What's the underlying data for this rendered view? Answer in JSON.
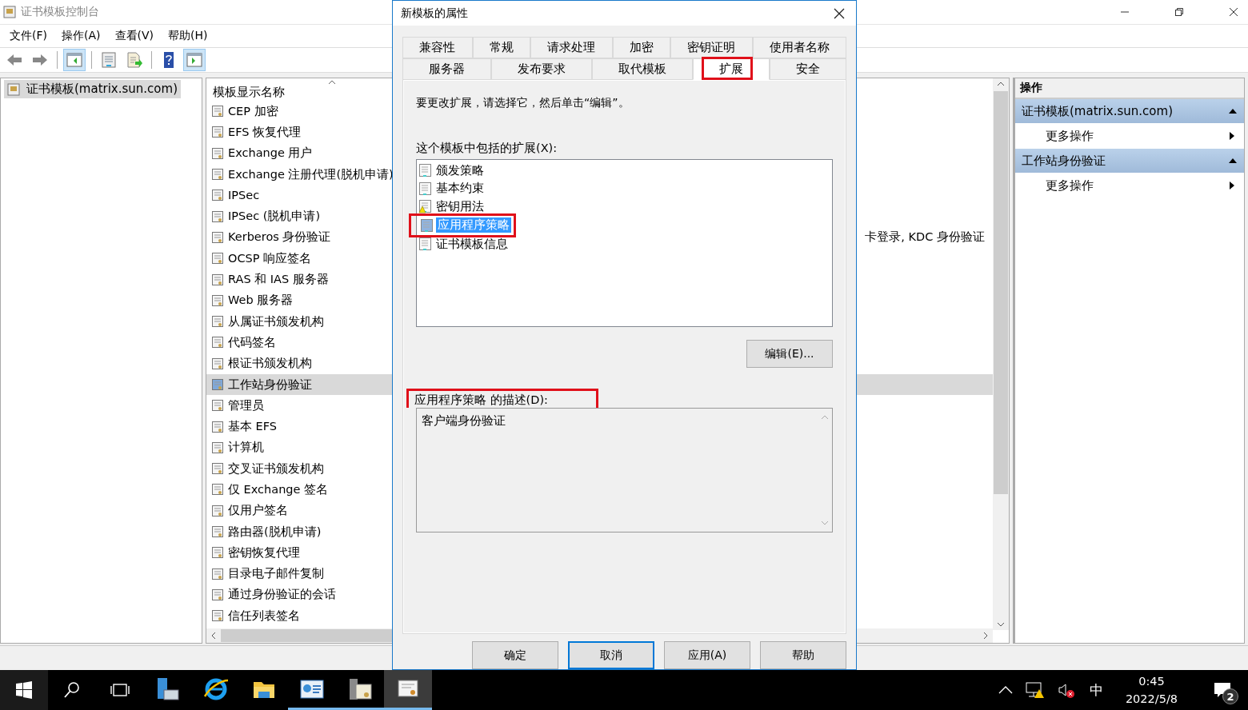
{
  "main_window": {
    "title": "证书模板控制台",
    "menu": [
      "文件(F)",
      "操作(A)",
      "查看(V)",
      "帮助(H)"
    ],
    "toolbar": [
      {
        "kind": "back",
        "pressed": false
      },
      {
        "kind": "forward",
        "pressed": false
      },
      {
        "kind": "tree",
        "pressed": true
      },
      {
        "kind": "properties",
        "pressed": false
      },
      {
        "kind": "export",
        "pressed": false
      },
      {
        "kind": "help",
        "pressed": false
      },
      {
        "kind": "pane",
        "pressed": true
      }
    ],
    "tree": [
      {
        "label": "证书模板(matrix.sun.com)",
        "selected": true
      }
    ],
    "table": {
      "columns": [
        "模板显示名称"
      ],
      "rows": [
        {
          "name": "CEP 加密",
          "selected": false
        },
        {
          "name": "EFS 恢复代理",
          "selected": false
        },
        {
          "name": "Exchange 用户",
          "selected": false
        },
        {
          "name": "Exchange 注册代理(脱机申请)",
          "selected": false
        },
        {
          "name": "IPSec",
          "selected": false
        },
        {
          "name": "IPSec (脱机申请)",
          "selected": false
        },
        {
          "name": "Kerberos 身份验证",
          "selected": false,
          "column_2": "卡登录, KDC 身份验证"
        },
        {
          "name": "OCSP 响应签名",
          "selected": false
        },
        {
          "name": "RAS 和 IAS 服务器",
          "selected": false
        },
        {
          "name": "Web 服务器",
          "selected": false
        },
        {
          "name": "从属证书颁发机构",
          "selected": false
        },
        {
          "name": "代码签名",
          "selected": false
        },
        {
          "name": "根证书颁发机构",
          "selected": false
        },
        {
          "name": "工作站身份验证",
          "selected": true
        },
        {
          "name": "管理员",
          "selected": false
        },
        {
          "name": "基本 EFS",
          "selected": false
        },
        {
          "name": "计算机",
          "selected": false
        },
        {
          "name": "交叉证书颁发机构",
          "selected": false
        },
        {
          "name": "仅 Exchange 签名",
          "selected": false
        },
        {
          "name": "仅用户签名",
          "selected": false
        },
        {
          "name": "路由器(脱机申请)",
          "selected": false
        },
        {
          "name": "密钥恢复代理",
          "selected": false
        },
        {
          "name": "目录电子邮件复制",
          "selected": false
        },
        {
          "name": "通过身份验证的会话",
          "selected": false
        },
        {
          "name": "信任列表签名",
          "selected": false
        }
      ]
    },
    "actions": {
      "title": "操作",
      "groups": [
        {
          "title": "证书模板(matrix.sun.com)",
          "expanded": true,
          "items": [
            "更多操作"
          ]
        },
        {
          "title": "工作站身份验证",
          "expanded": true,
          "items": [
            "更多操作"
          ]
        }
      ]
    }
  },
  "dialog": {
    "title": "新模板的属性",
    "tab_rows": [
      [
        {
          "label": "兼容性",
          "selected": false,
          "annotated": false
        },
        {
          "label": "常规",
          "selected": false,
          "annotated": false
        },
        {
          "label": "请求处理",
          "selected": false,
          "annotated": false
        },
        {
          "label": "加密",
          "selected": false,
          "annotated": false
        },
        {
          "label": "密钥证明",
          "selected": false,
          "annotated": false
        },
        {
          "label": "使用者名称",
          "selected": false,
          "annotated": false
        }
      ],
      [
        {
          "label": "服务器",
          "selected": false,
          "annotated": false
        },
        {
          "label": "发布要求",
          "selected": false,
          "annotated": false
        },
        {
          "label": "取代模板",
          "selected": false,
          "annotated": false
        },
        {
          "label": "扩展",
          "selected": true,
          "annotated": true
        },
        {
          "label": "安全",
          "selected": false,
          "annotated": false
        }
      ]
    ],
    "instruction": "要更改扩展，请选择它，然后单击“编辑”。",
    "extensions_label": "这个模板中包括的扩展(X):",
    "extensions": [
      {
        "label": "颁发策略",
        "selected": false,
        "warning": false,
        "annotated": false
      },
      {
        "label": "基本约束",
        "selected": false,
        "warning": false,
        "annotated": false
      },
      {
        "label": "密钥用法",
        "selected": false,
        "warning": true,
        "annotated": false
      },
      {
        "label": "应用程序策略",
        "selected": true,
        "warning": false,
        "annotated": true
      },
      {
        "label": "证书模板信息",
        "selected": false,
        "warning": false,
        "annotated": false
      }
    ],
    "edit_button": "编辑(E)...",
    "description_label": "应用程序策略 的描述(D):",
    "description": "客户端身份验证",
    "description_annotated": true,
    "buttons": [
      {
        "label": "确定",
        "focused": false
      },
      {
        "label": "取消",
        "focused": true
      },
      {
        "label": "应用(A)",
        "focused": false
      },
      {
        "label": "帮助",
        "focused": false
      }
    ]
  },
  "taskbar": {
    "apps": [
      {
        "kind": "server",
        "running": false,
        "active": false
      },
      {
        "kind": "ie",
        "running": false,
        "active": false
      },
      {
        "kind": "folder",
        "running": false,
        "active": false
      },
      {
        "kind": "card",
        "running": true,
        "active": false
      },
      {
        "kind": "certsrv",
        "running": true,
        "active": false
      },
      {
        "kind": "cert",
        "running": true,
        "active": true
      }
    ],
    "ime": "中",
    "time": "0:45",
    "date": "2022/5/8",
    "notifications": "2"
  }
}
